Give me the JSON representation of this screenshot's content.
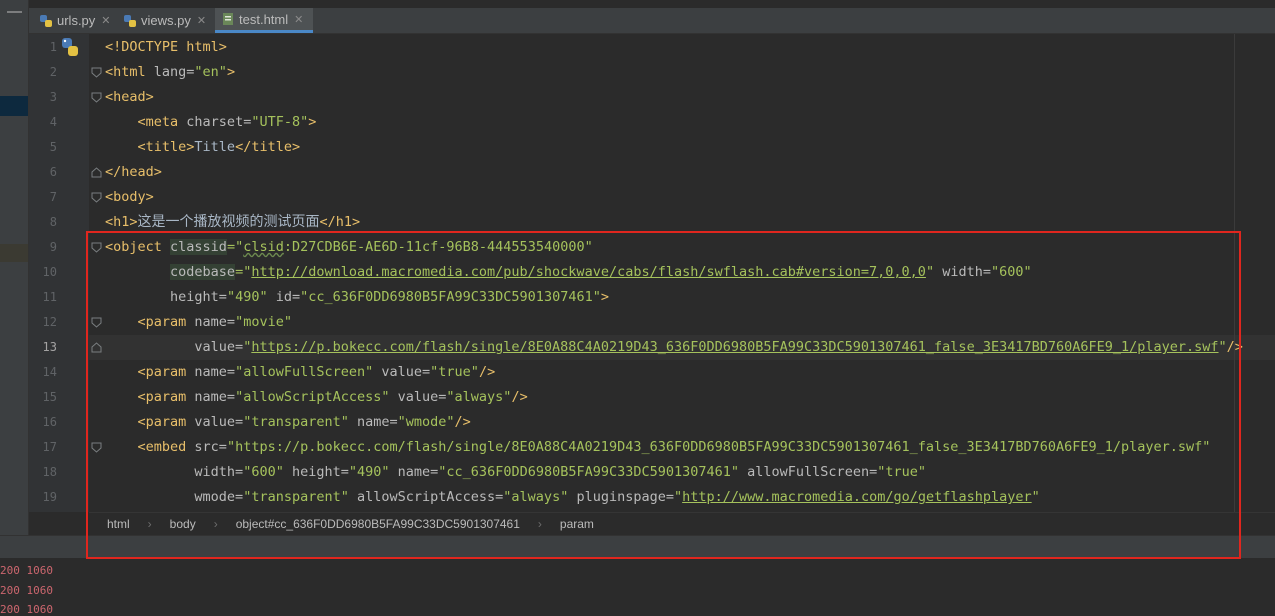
{
  "tabs": [
    {
      "label": "urls.py",
      "icon": "python-file-icon",
      "active": false
    },
    {
      "label": "views.py",
      "icon": "python-file-icon",
      "active": false
    },
    {
      "label": "test.html",
      "icon": "html-file-icon",
      "active": true
    }
  ],
  "tab_close_glyph": "✕",
  "line_numbers": [
    "1",
    "2",
    "3",
    "4",
    "5",
    "6",
    "7",
    "8",
    "9",
    "10",
    "11",
    "12",
    "13",
    "14",
    "15",
    "16",
    "17",
    "18",
    "19"
  ],
  "current_line": "13",
  "code": {
    "l1": {
      "doctype": "<!DOCTYPE html>"
    },
    "l2": {
      "open": "<html ",
      "attr": "lang=",
      "val": "\"en\"",
      "close": ">"
    },
    "l3": {
      "tag": "<head>"
    },
    "l4": {
      "open": "<meta ",
      "attr": "charset=",
      "val": "\"UTF-8\"",
      "close": ">"
    },
    "l5": {
      "open": "<title>",
      "text": "Title",
      "close": "</title>"
    },
    "l6": {
      "tag": "</head>"
    },
    "l7": {
      "tag": "<body>"
    },
    "l8": {
      "open": "<h1>",
      "text": "这是一个播放视频的测试页面",
      "close": "</h1>"
    },
    "l9": {
      "open": "<object ",
      "attr": "classid",
      "eq": "=",
      "q1": "\"",
      "url": "clsid",
      "val": ":D27CDB6E-AE6D-11cf-96B8-444553540000\""
    },
    "l10": {
      "attr": "codebase",
      "eq": "=\"",
      "url": "http://download.macromedia.com/pub/shockwave/cabs/flash/swflash.cab#version=7,0,0,0",
      "q": "\" ",
      "attr2": "width=",
      "val2": "\"600\""
    },
    "l11": {
      "attr": "height=",
      "val": "\"490\" ",
      "attr2": "id=",
      "val2": "\"cc_636F0DD6980B5FA99C33DC5901307461\"",
      "close": ">"
    },
    "l12": {
      "open": "<param ",
      "attr": "name=",
      "val": "\"movie\""
    },
    "l13": {
      "attr": "value=",
      "q1": "\"",
      "url": "https://p.bokecc.com/flash/single/8E0A88C4A0219D43_636F0DD6980B5FA99C33DC5901307461_false_3E3417BD760A6FE9_1/player.swf",
      "q2": "\"",
      "close": "/>"
    },
    "l14": {
      "open": "<param ",
      "attr": "name=",
      "val": "\"allowFullScreen\" ",
      "attr2": "value=",
      "val2": "\"true\"",
      "close": "/>"
    },
    "l15": {
      "open": "<param ",
      "attr": "name=",
      "val": "\"allowScriptAccess\" ",
      "attr2": "value=",
      "val2": "\"always\"",
      "close": "/>"
    },
    "l16": {
      "open": "<param ",
      "attr": "value=",
      "val": "\"transparent\" ",
      "attr2": "name=",
      "val2": "\"wmode\"",
      "close": "/>"
    },
    "l17": {
      "open": "<embed ",
      "attr": "src=",
      "val": "\"https://p.bokecc.com/flash/single/8E0A88C4A0219D43_636F0DD6980B5FA99C33DC5901307461_false_3E3417BD760A6FE9_1/player.swf\""
    },
    "l18": {
      "attr": "width=",
      "val": "\"600\" ",
      "attr2": "height=",
      "val2": "\"490\" ",
      "attr3": "name=",
      "val3": "\"cc_636F0DD6980B5FA99C33DC5901307461\" ",
      "attr4": "allowFullScreen=",
      "val4": "\"true\""
    },
    "l19": {
      "attr": "wmode=",
      "val": "\"transparent\" ",
      "attr2": "allowScriptAccess=",
      "val2": "\"always\" ",
      "attr3": "pluginspage=",
      "q": "\"",
      "url": "http://www.macromedia.com/go/getflashplayer",
      "q2": "\""
    }
  },
  "breadcrumb": [
    "html",
    "body",
    "object#cc_636F0DD6980B5FA99C33DC5901307461",
    "param"
  ],
  "breadcrumb_sep": "›",
  "console_lines": [
    "200 1060",
    "200 1060",
    "200 1060"
  ],
  "colors": {
    "tag": "#e8bf6a",
    "attr": "#bababa",
    "value": "#a5c25c",
    "text": "#a9b7c6",
    "annotation_box": "#e0261e",
    "background": "#2b2b2b"
  }
}
